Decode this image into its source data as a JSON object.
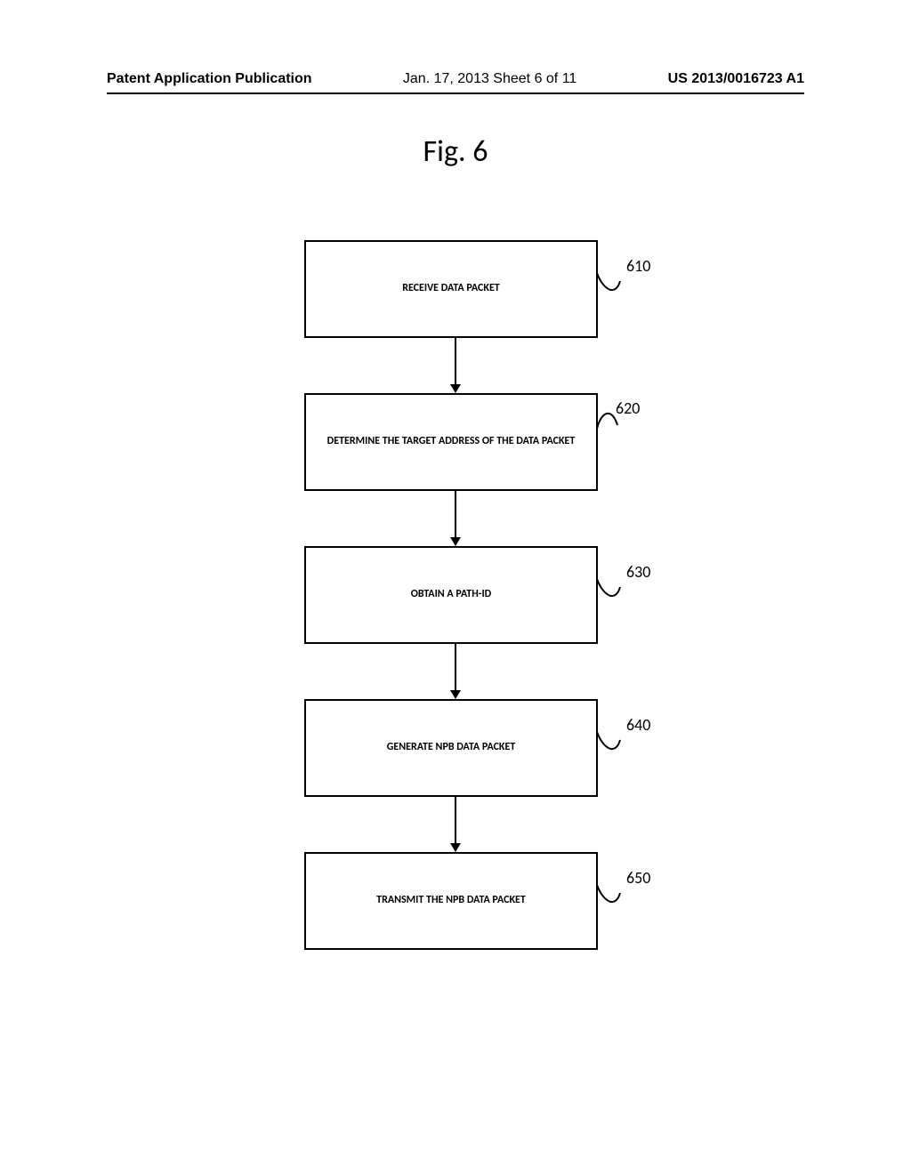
{
  "header": {
    "left": "Patent Application Publication",
    "center": "Jan. 17, 2013  Sheet 6 of 11",
    "right": "US 2013/0016723 A1"
  },
  "figure_title": "Fig. 6",
  "steps": [
    {
      "label": "RECEIVE DATA PACKET",
      "ref": "610"
    },
    {
      "label": "DETERMINE THE TARGET ADDRESS OF THE DATA PACKET",
      "ref": "620"
    },
    {
      "label": "OBTAIN A PATH-ID",
      "ref": "630"
    },
    {
      "label": "GENERATE NPB DATA PACKET",
      "ref": "640"
    },
    {
      "label": "TRANSMIT THE NPB DATA PACKET",
      "ref": "650"
    }
  ],
  "chart_data": {
    "type": "flowchart",
    "title": "Fig. 6",
    "nodes": [
      {
        "id": "610",
        "text": "RECEIVE DATA PACKET"
      },
      {
        "id": "620",
        "text": "DETERMINE THE TARGET ADDRESS OF THE DATA PACKET"
      },
      {
        "id": "630",
        "text": "OBTAIN A PATH-ID"
      },
      {
        "id": "640",
        "text": "GENERATE NPB DATA PACKET"
      },
      {
        "id": "650",
        "text": "TRANSMIT THE NPB DATA PACKET"
      }
    ],
    "edges": [
      {
        "from": "610",
        "to": "620"
      },
      {
        "from": "620",
        "to": "630"
      },
      {
        "from": "630",
        "to": "640"
      },
      {
        "from": "640",
        "to": "650"
      }
    ]
  }
}
